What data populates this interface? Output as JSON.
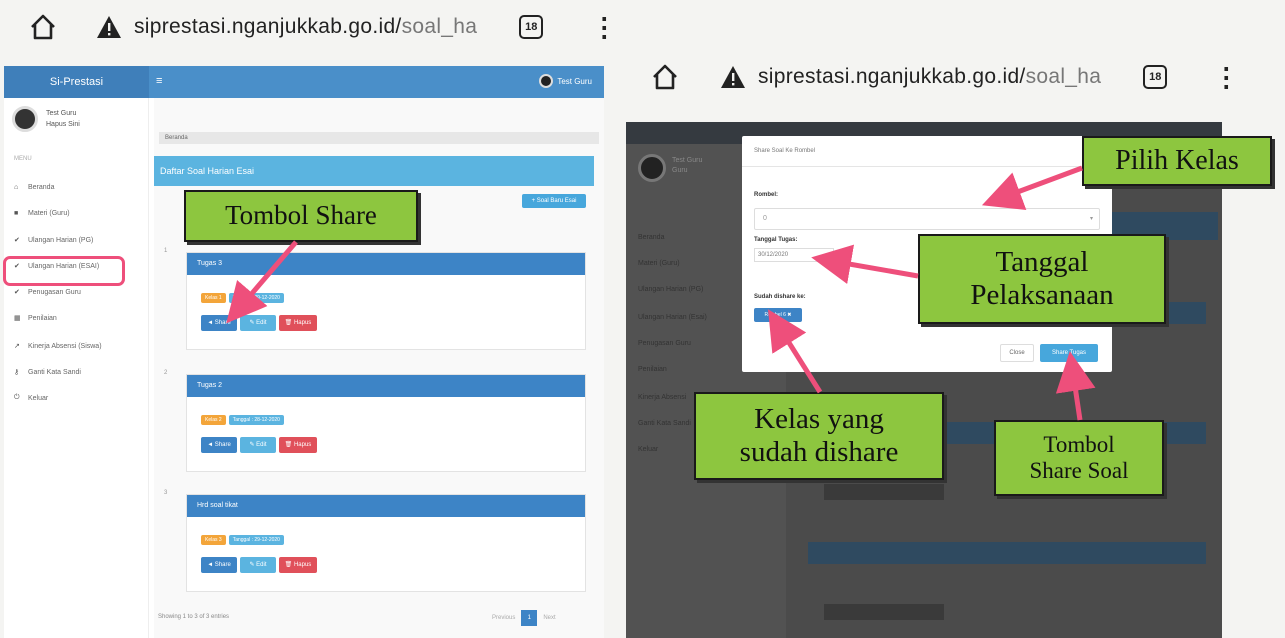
{
  "left_browser": {
    "url_host": "siprestasi.nganjukkab.go.id/",
    "url_path": "soal_ha",
    "tab_count": "18"
  },
  "right_browser": {
    "url_host": "siprestasi.nganjukkab.go.id/",
    "url_path": "soal_ha",
    "tab_count": "18"
  },
  "left_app": {
    "brand": "Si-Prestasi",
    "hamburger": "≡",
    "top_user": "Test Guru",
    "profile_name": "Test Guru",
    "profile_role": "Hapus Sini",
    "menu_label": "MENU",
    "sidebar": [
      {
        "label": "Beranda",
        "icon": "home-icon"
      },
      {
        "label": "Materi (Guru)",
        "icon": "folder-icon"
      },
      {
        "label": "Ulangan Harian (PG)",
        "icon": "check-icon"
      },
      {
        "label": "Ulangan Harian (ESAI)",
        "icon": "check-icon"
      },
      {
        "label": "Penugasan Guru",
        "icon": "check-icon"
      },
      {
        "label": "Penilaian",
        "icon": "table-icon"
      },
      {
        "label": "Kinerja Absensi (Siswa)",
        "icon": "chart-icon"
      },
      {
        "label": "Ganti Kata Sandi",
        "icon": "key-icon"
      },
      {
        "label": "Keluar",
        "icon": "power-icon"
      }
    ],
    "breadcrumb": "Beranda",
    "page_title": "Daftar Soal Harian Esai",
    "add_button": "+ Soal Baru Esai",
    "cards": [
      {
        "num": "1",
        "title": "Tugas 3",
        "badge_class": "Kelas 1",
        "badge_date": "Tanggal : 29-12-2020",
        "share": "◄ Share",
        "edit": "✎ Edit",
        "delete": "🗑 Hapus"
      },
      {
        "num": "2",
        "title": "Tugas 2",
        "badge_class": "Kelas 2",
        "badge_date": "Tanggal : 28-12-2020",
        "share": "◄ Share",
        "edit": "✎ Edit",
        "delete": "🗑 Hapus"
      },
      {
        "num": "3",
        "title": "Hrd soal tikat",
        "badge_class": "Kelas 3",
        "badge_date": "Tanggal : 29-12-2020",
        "share": "◄ Share",
        "edit": "✎ Edit",
        "delete": "🗑 Hapus"
      }
    ],
    "footer_info": "Showing 1 to 3 of 3 entries",
    "pager": {
      "prev": "Previous",
      "current": "1",
      "next": "Next"
    }
  },
  "right_app": {
    "profile_name": "Test Guru",
    "profile_role": "Guru",
    "sidebar": [
      "Beranda",
      "Materi (Guru)",
      "Ulangan Harian (PG)",
      "Ulangan Harian (Esai)",
      "Penugasan Guru",
      "Penilaian",
      "Kinerja Absensi",
      "Ganti Kata Sandi",
      "Keluar"
    ],
    "modal": {
      "title": "Share Soal Ke Rombel",
      "rombel_label": "Rombel:",
      "rombel_value": "0",
      "date_label": "Tanggal Tugas:",
      "date_value": "30/12/2020",
      "shared_label": "Sudah dishare ke:",
      "shared_button": "Rombel 6 ✖",
      "close_button": "Close",
      "share_button": "Share Tugas"
    }
  },
  "callouts": {
    "tombol_share": "Tombol Share",
    "pilih_kelas": "Pilih Kelas",
    "tanggal_line1": "Tanggal",
    "tanggal_line2": "Pelaksanaan",
    "kelas_line1": "Kelas yang",
    "kelas_line2": "sudah dishare",
    "tombol_soal_line1": "Tombol",
    "tombol_soal_line2": "Share Soal"
  },
  "colors": {
    "highlight": "#ee4f7b",
    "callout_green": "#8dc63f",
    "primary_blue": "#3d84c6"
  }
}
